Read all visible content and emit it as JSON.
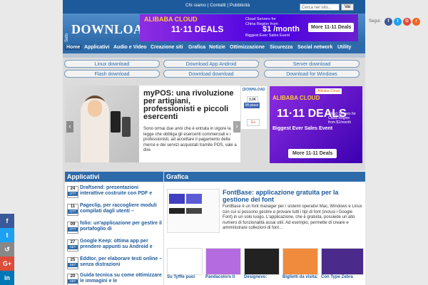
{
  "topbar": {
    "links": "Chi siamo | Contatti | Pubblicità",
    "search_placeholder": "Cerca nel sito...",
    "search_button": "Vai"
  },
  "header": {
    "logo_prefix": "Solo",
    "logo": "DOWNLOAD"
  },
  "ad_top": {
    "line1": "ALIBABA CLOUD",
    "line2": "11·11 DEALS",
    "line3": "Cloud Servers for China Region from",
    "price": "$1 /month",
    "line4": "Biggest Ever Sales Event",
    "cta": "More 11-11 Deals"
  },
  "follow": {
    "label": "Segui:"
  },
  "nav": [
    "Home",
    "Applicativi",
    "Audio e Video",
    "Creazione siti",
    "Grafica",
    "Notizie",
    "Ottimizzazione",
    "Sicurezza",
    "Social network",
    "Utility"
  ],
  "pills": [
    "Linux download",
    "Download App Android",
    "Server download",
    "Flash download",
    "Download download",
    "Download for Windows"
  ],
  "feature": {
    "title": "myPOS: una rivoluzione per artigiani, professionisti e piccoli esercenti",
    "text": "Sono ormai due anni che è entrata in vigore la legge che obbliga gli esercenti commerciali e i professionisti, ad accettare il pagamento della merce e dei servizi acquistati tramite POS, vale a dire"
  },
  "social_box": {
    "logo": "[DOWNLOAD",
    "count": "3,9K",
    "like": "Mi piace",
    "gplus": "G+"
  },
  "ad_side": {
    "tag": "Alibaba Cloud",
    "line1": "ALIBABA CLOUD",
    "line2": "11·11 DEALS",
    "line3": "Cloud Servers for China Region from $1/month",
    "line4": "Biggest Ever Sales Event",
    "cta": "More 11-11 Deals"
  },
  "applicativi": {
    "heading": "Applicativi",
    "items": [
      {
        "day": "24",
        "mon": "OTT",
        "title": "Draftsend: presentazioni interattive costruite con PDF e"
      },
      {
        "day": "11",
        "mon": "OTT",
        "title": "Pageclip, per raccogliere moduli compilati dagli utenti –"
      },
      {
        "day": "09",
        "mon": "OTT",
        "title": "folio: un'applicazione per gestire il portafoglio di"
      },
      {
        "day": "27",
        "mon": "SET",
        "title": "Google Keep: ottima app per prendere appunti su Android e"
      },
      {
        "day": "25",
        "mon": "SET",
        "title": "Eddtor, per elaborare testi online – senza distrazioni"
      },
      {
        "day": "20",
        "mon": "SET",
        "title": "Guida tecnica su come ottimizzare le immagini e le"
      }
    ]
  },
  "grafica": {
    "heading": "Grafica",
    "title": "FontBase: applicazione gratuita per la gestione dei font",
    "text": "FontBase è un font manager per i sistemi operativi Mac, Windows e Linux con cui si possono gestire e provare tutti i tipi di font (inclusi i Google Font) in un solo luogo. L'applicazione, che è gratuita, possiede un alto numero di funzionalità assai utili. Ad esempio, permette di creare e amministrare collezioni di font…",
    "thumbs": [
      "Su Tyffle puoi",
      "Pandacolors ti",
      "Designevo:",
      "Biglietti da visita:",
      "Con Type Zebra"
    ]
  },
  "share": [
    "f",
    "t",
    "↺",
    "G+",
    "in"
  ],
  "colors": {
    "brand": "#2d6aa9",
    "facebook": "#3b5998",
    "twitter": "#1da1f2",
    "gplus": "#dd4b39"
  }
}
